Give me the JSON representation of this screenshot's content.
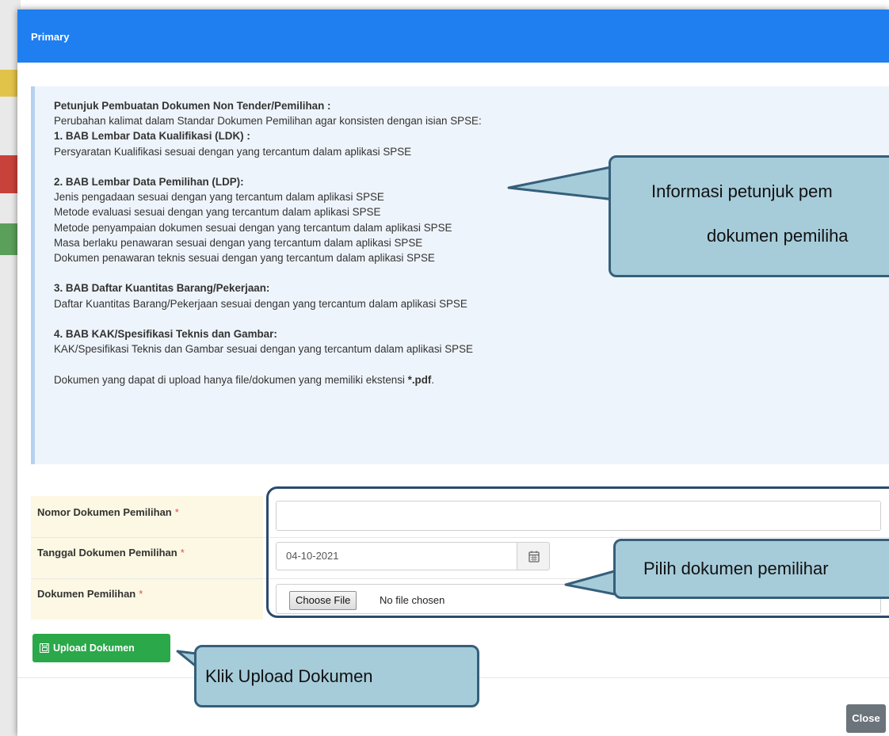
{
  "modal": {
    "title": "Primary",
    "close_label": "Close"
  },
  "instructions": {
    "heading": "Petunjuk Pembuatan Dokumen Non Tender/Pemilihan :",
    "intro": "Perubahan kalimat dalam Standar Dokumen Pemilihan agar konsisten dengan isian SPSE:",
    "sections": [
      {
        "title": "1. BAB Lembar Data Kualifikasi (LDK) :",
        "lines": [
          "Persyaratan Kualifikasi sesuai dengan yang tercantum dalam aplikasi SPSE"
        ]
      },
      {
        "title": "2. BAB Lembar Data Pemilihan (LDP):",
        "lines": [
          "Jenis pengadaan sesuai dengan yang tercantum dalam aplikasi SPSE",
          "Metode evaluasi sesuai dengan yang tercantum dalam aplikasi SPSE",
          "Metode penyampaian dokumen sesuai dengan yang tercantum dalam aplikasi SPSE",
          "Masa berlaku penawaran sesuai dengan yang tercantum dalam aplikasi SPSE",
          "Dokumen penawaran teknis sesuai dengan yang tercantum dalam aplikasi SPSE"
        ]
      },
      {
        "title": "3. BAB Daftar Kuantitas Barang/Pekerjaan:",
        "lines": [
          "Daftar Kuantitas Barang/Pekerjaan sesuai dengan yang tercantum dalam aplikasi SPSE"
        ]
      },
      {
        "title": "4. BAB KAK/Spesifikasi Teknis dan Gambar:",
        "lines": [
          "KAK/Spesifikasi Teknis dan Gambar sesuai dengan yang tercantum dalam aplikasi SPSE"
        ]
      }
    ],
    "note_prefix": "Dokumen yang dapat di upload hanya file/dokumen yang memiliki ekstensi ",
    "note_ext": "*.pdf",
    "note_suffix": "."
  },
  "form": {
    "required_mark": "*",
    "nomor_label": "Nomor Dokumen Pemilihan",
    "nomor_value": "",
    "tanggal_label": "Tanggal Dokumen Pemilihan",
    "tanggal_value": "04-10-2021",
    "dokumen_label": "Dokumen Pemilihan",
    "choose_file_label": "Choose File",
    "file_status": "No file chosen",
    "upload_label": "Upload Dokumen"
  },
  "callouts": {
    "info_line1": "Informasi petunjuk pem",
    "info_line2": "dokumen pemiliha",
    "pilih": "Pilih dokumen pemilihar",
    "klik": "Klik Upload Dokumen"
  },
  "colors": {
    "header_blue": "#1f7ef0",
    "upload_green": "#2ba84a",
    "close_gray": "#6b737b",
    "callout_fill": "#a6ccda",
    "callout_border": "#355f7a",
    "label_bg": "#fcf8e3",
    "required_red": "#d9534f"
  },
  "icons": {
    "calendar": "calendar-icon",
    "save": "save-icon"
  }
}
